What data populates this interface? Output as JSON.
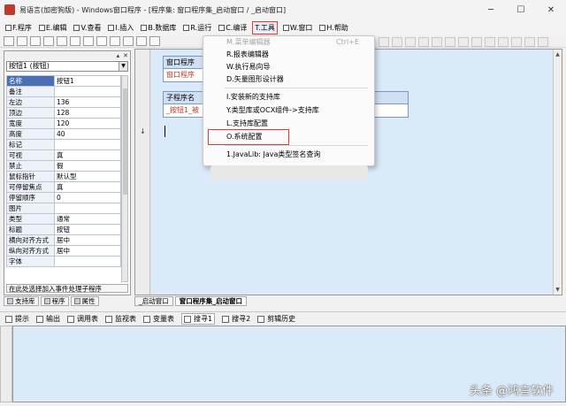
{
  "window": {
    "title": "易语言(加密狗版) - Windows窗口程序 - [程序集: 窗口程序集_启动窗口 / _启动窗口]",
    "controls": [
      "─",
      "☐",
      "✕"
    ]
  },
  "menubar": {
    "items": [
      {
        "label": "F.程序"
      },
      {
        "label": "E.编辑"
      },
      {
        "label": "V.查看"
      },
      {
        "label": "I.插入"
      },
      {
        "label": "B.数据库"
      },
      {
        "label": "R.运行"
      },
      {
        "label": "C.编译"
      },
      {
        "label": "T.工具",
        "highlight": true
      },
      {
        "label": "W.窗口"
      },
      {
        "label": "H.帮助"
      }
    ]
  },
  "tools_menu": {
    "items": [
      {
        "label": "M.菜单编辑器",
        "shortcut": "Ctrl+E",
        "disabled": true
      },
      {
        "label": "R.报表编辑器"
      },
      {
        "label": "W.执行易向导"
      },
      {
        "label": "D.矢量图形设计器"
      },
      {
        "label": "I.安装新的支持库"
      },
      {
        "label": "Y.类型库或OCX组件->支持库"
      },
      {
        "label": "L.支持库配置"
      },
      {
        "label": "O.系统配置",
        "highlight": true
      },
      {
        "label": "1.JavaLib: Java类型签名查询"
      }
    ]
  },
  "left_panel": {
    "header_buttons": [
      "▴",
      "✕"
    ],
    "object_select": "按钮1 (按钮)",
    "properties": [
      {
        "name": "名称",
        "value": "按钮1",
        "selected": true
      },
      {
        "name": "备注",
        "value": ""
      },
      {
        "name": "左边",
        "value": "136"
      },
      {
        "name": "顶边",
        "value": "128"
      },
      {
        "name": "宽度",
        "value": "120"
      },
      {
        "name": "高度",
        "value": "40"
      },
      {
        "name": "标记",
        "value": ""
      },
      {
        "name": "可视",
        "value": "真"
      },
      {
        "name": "禁止",
        "value": "假"
      },
      {
        "name": "鼠标指针",
        "value": "默认型"
      },
      {
        "name": "可停留焦点",
        "value": "真"
      },
      {
        "name": "停留顺序",
        "value": "0"
      },
      {
        "name": "图片",
        "value": ""
      },
      {
        "name": "类型",
        "value": "通常"
      },
      {
        "name": "标题",
        "value": "按钮"
      },
      {
        "name": "横向对齐方式",
        "value": "居中"
      },
      {
        "name": "纵向对齐方式",
        "value": "居中"
      },
      {
        "name": "字体",
        "value": ""
      }
    ],
    "footer": "在此处选择加入事件处理子程序",
    "tabs": [
      "支持库",
      "程序",
      "属性"
    ]
  },
  "editor": {
    "box1": {
      "header": "窗口程序",
      "row": "窗口程序"
    },
    "box2": {
      "header": "子程序名",
      "row": "_按钮1_被"
    },
    "gutter_arrow": "↓",
    "tabs": [
      "_启动窗口",
      "窗口程序集_启动窗口"
    ]
  },
  "bottom": {
    "tabs": [
      "提示",
      "输出",
      "调用表",
      "监视表",
      "变量表",
      "搜寻1",
      "搜寻2",
      "剪辑历史"
    ]
  },
  "watermark": "头条 @鸿言软件"
}
